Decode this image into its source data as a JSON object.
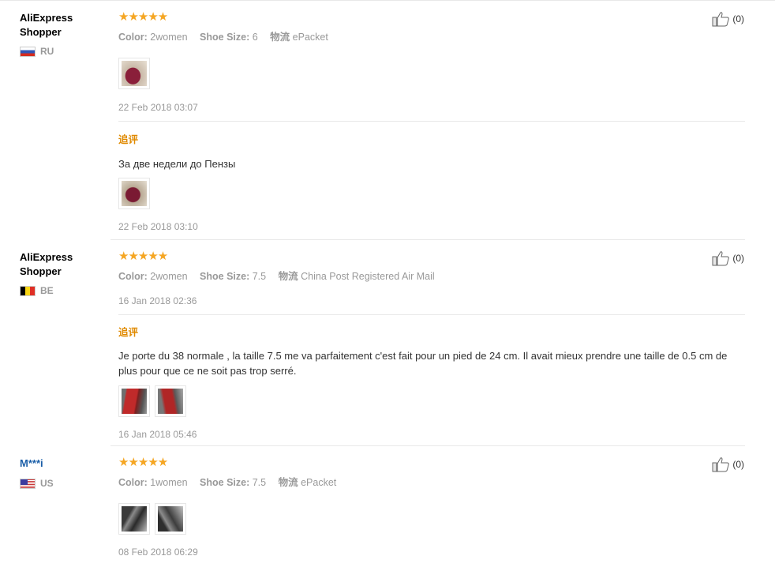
{
  "labels": {
    "color": "Color:",
    "shoe_size": "Shoe Size:",
    "shipping": "物流",
    "followup": "追评",
    "stars": "★★★★★"
  },
  "reviews": [
    {
      "user": "AliExpress Shopper",
      "user_line1": "AliExpress",
      "user_line2": "Shopper",
      "country": "RU",
      "likes": "(0)",
      "color": "2women",
      "shoe_size": "6",
      "shipping": "ePacket",
      "date": "22 Feb 2018 03:07",
      "followup_text": "За две недели до Пензы",
      "followup_date": "22 Feb 2018 03:10"
    },
    {
      "user": "AliExpress Shopper",
      "user_line1": "AliExpress",
      "user_line2": "Shopper",
      "country": "BE",
      "likes": "(0)",
      "color": "2women",
      "shoe_size": "7.5",
      "shipping": "China Post Registered Air Mail",
      "date": "16 Jan 2018 02:36",
      "followup_text": "Je porte du 38 normale , la taille 7.5 me va parfaitement c'est fait pour un pied de 24 cm. Il avait mieux prendre une taille de 0.5 cm de plus pour que ce ne soit pas trop serré.",
      "followup_date": "16 Jan 2018 05:46"
    },
    {
      "user": "M***i",
      "country": "US",
      "likes": "(0)",
      "color": "1women",
      "shoe_size": "7.5",
      "shipping": "ePacket",
      "date": "08 Feb 2018 06:29"
    }
  ]
}
